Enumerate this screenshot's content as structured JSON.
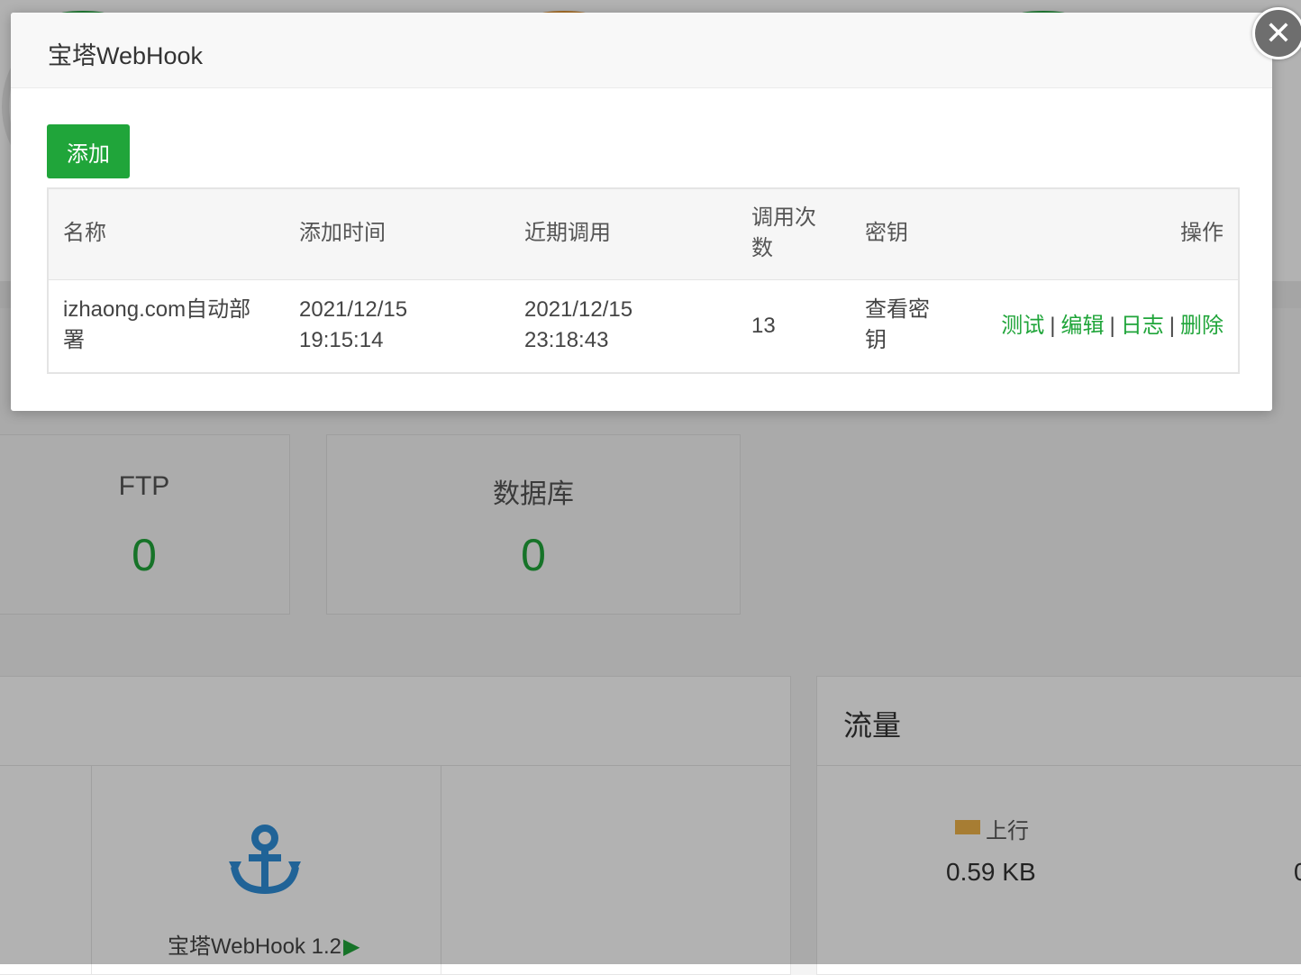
{
  "modal": {
    "title": "宝塔WebHook",
    "add_button": "添加",
    "columns": [
      "名称",
      "添加时间",
      "近期调用",
      "调用次数",
      "密钥",
      "操作"
    ],
    "rows": [
      {
        "name": "izhaong.com自动部署",
        "added_time": "2021/12/15 19:15:14",
        "recent_call": "2021/12/15 23:18:43",
        "call_count": "13",
        "key_link": "查看密钥",
        "actions": [
          "测试",
          "编辑",
          "日志",
          "删除"
        ]
      }
    ],
    "separator": "|"
  },
  "background": {
    "cards": [
      {
        "label": "FTP",
        "value": "0"
      },
      {
        "label": "数据库",
        "value": "0"
      }
    ],
    "plugin": {
      "name": "宝塔WebHook 1.2",
      "play": "▶"
    },
    "traffic": {
      "title": "流量",
      "legend_up": "上行",
      "up_value": "0.59 KB",
      "down_value_partial": "0"
    }
  },
  "colors": {
    "accent": "#20a53a",
    "upload_legend": "#f0b44a",
    "anchor_icon": "#2f8fd8"
  },
  "icons": {
    "close": "close-icon",
    "plugin": "anchor-icon"
  }
}
